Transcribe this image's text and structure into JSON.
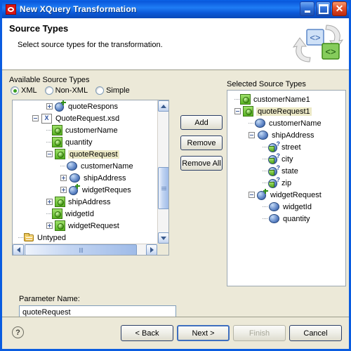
{
  "window": {
    "title": "New XQuery Transformation",
    "app_icon": "xquery-app-icon",
    "controls": {
      "minimize": "minimize-icon",
      "maximize": "maximize-icon",
      "close": "close-icon"
    }
  },
  "header": {
    "title": "Source Types",
    "description": "Select source types for the transformation.",
    "banner_icon": "xml-transformation-icon"
  },
  "available": {
    "label": "Available Source Types",
    "radios": [
      {
        "label": "XML",
        "selected": true
      },
      {
        "label": "Non-XML",
        "selected": false
      },
      {
        "label": "Simple",
        "selected": false
      }
    ],
    "tree": [
      {
        "label": "quoteRespons",
        "icon": "element-ref-icon",
        "indent": 3,
        "expander": "plus",
        "clipped": true
      },
      {
        "label": "QuoteRequest.xsd",
        "icon": "xsd-file-icon",
        "indent": 2,
        "expander": "minus"
      },
      {
        "label": "customerName",
        "icon": "global-element-icon",
        "indent": 3,
        "expander": "none"
      },
      {
        "label": "quantity",
        "icon": "global-element-icon",
        "indent": 3,
        "expander": "none"
      },
      {
        "label": "quoteRequest",
        "icon": "global-element-icon",
        "indent": 3,
        "expander": "minus",
        "selected": true
      },
      {
        "label": "customerName",
        "icon": "local-element-icon",
        "indent": 4,
        "expander": "none",
        "clipped": true
      },
      {
        "label": "shipAddress",
        "icon": "local-element-icon",
        "indent": 4,
        "expander": "plus"
      },
      {
        "label": "widgetReques",
        "icon": "element-ref-icon",
        "indent": 4,
        "expander": "plus",
        "clipped": true
      },
      {
        "label": "shipAddress",
        "icon": "global-element-icon",
        "indent": 3,
        "expander": "plus"
      },
      {
        "label": "widgetId",
        "icon": "global-element-icon",
        "indent": 3,
        "expander": "none"
      },
      {
        "label": "widgetRequest",
        "icon": "global-element-icon",
        "indent": 3,
        "expander": "plus"
      },
      {
        "label": "Untyped",
        "icon": "folder-icon",
        "indent": 1,
        "expander": "none"
      }
    ]
  },
  "transfer_buttons": {
    "add": "Add",
    "remove": "Remove",
    "remove_all": "Remove All"
  },
  "selected": {
    "label": "Selected Source Types",
    "tree": [
      {
        "label": "customerName1",
        "icon": "global-element-icon",
        "indent": 1,
        "expander": "none"
      },
      {
        "label": "quoteRequest1",
        "icon": "global-element-icon",
        "indent": 1,
        "expander": "minus",
        "selected": true
      },
      {
        "label": "customerName",
        "icon": "local-element-icon",
        "indent": 2,
        "expander": "none"
      },
      {
        "label": "shipAddress",
        "icon": "local-element-icon",
        "indent": 2,
        "expander": "minus"
      },
      {
        "label": "street",
        "icon": "attribute-icon",
        "indent": 3,
        "expander": "none"
      },
      {
        "label": "city",
        "icon": "attribute-icon",
        "indent": 3,
        "expander": "none"
      },
      {
        "label": "state",
        "icon": "attribute-icon",
        "indent": 3,
        "expander": "none"
      },
      {
        "label": "zip",
        "icon": "attribute-icon",
        "indent": 3,
        "expander": "none"
      },
      {
        "label": "widgetRequest",
        "icon": "element-ref-icon",
        "indent": 2,
        "expander": "minus"
      },
      {
        "label": "widgetId",
        "icon": "local-element-icon",
        "indent": 3,
        "expander": "none"
      },
      {
        "label": "quantity",
        "icon": "local-element-icon",
        "indent": 3,
        "expander": "none"
      }
    ]
  },
  "parameter": {
    "label": "Parameter Name:",
    "value": "quoteRequest"
  },
  "footer": {
    "help": "?",
    "back": "< Back",
    "next": "Next >",
    "finish": "Finish",
    "cancel": "Cancel"
  },
  "colors": {
    "titlebar": "#0a58dc",
    "dialog_bg": "#ece9d8",
    "selection": "#ece9c6",
    "element_green": "#57b321",
    "element_blue": "#5b82c4"
  }
}
